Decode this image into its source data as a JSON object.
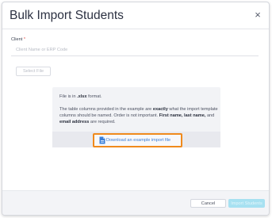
{
  "modal": {
    "title": "Bulk Import Students",
    "close_label": "×"
  },
  "client": {
    "label": "Client",
    "required_mark": "*",
    "placeholder": "Client Name or ERP Code",
    "value": ""
  },
  "select_file_label": "Select File",
  "info": {
    "line1_prefix": "File is in ",
    "line1_format": ".xlsx",
    "line1_suffix": " format.",
    "para_part1": "The table columns provided in the example are ",
    "para_exactly": "exactly",
    "para_part2": " what the import template columns should be named. Order is not important. ",
    "para_fields1": "First name, last name,",
    "para_part3": " and ",
    "para_fields2": "email address",
    "para_part4": " are required."
  },
  "download": {
    "label": "Download an example import file",
    "icon": "document-icon"
  },
  "footer": {
    "cancel_label": "Cancel",
    "import_label": "Import Students"
  },
  "colors": {
    "highlight_border": "#f08a1c",
    "link": "#3b7fd8",
    "primary_disabled": "#a7e1f1",
    "required": "#e5524a"
  }
}
